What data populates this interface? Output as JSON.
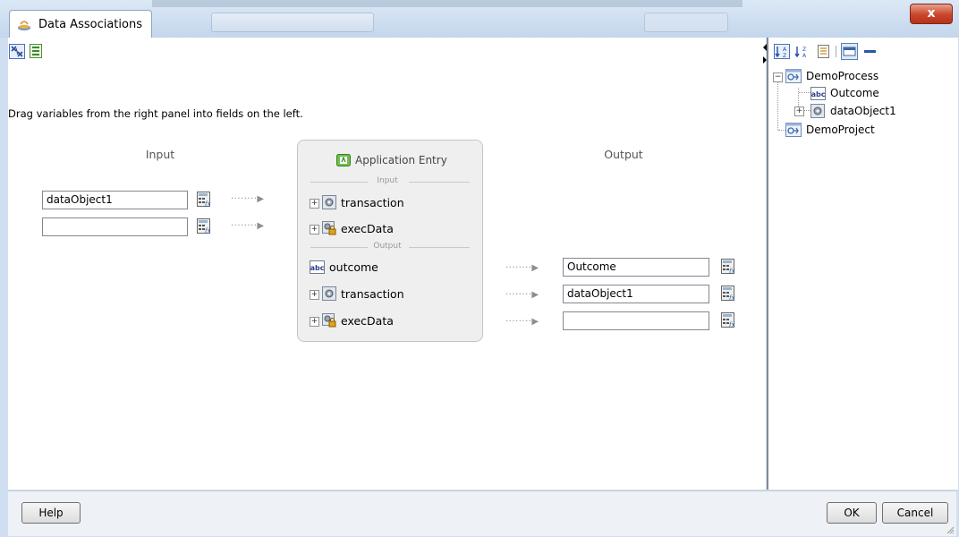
{
  "window": {
    "title": "Data Associations",
    "close_label": "x"
  },
  "description": "Drag variables from the right panel into fields on the left.",
  "input_section": {
    "header": "Input",
    "fields": [
      {
        "value": "dataObject1"
      },
      {
        "value": ""
      }
    ]
  },
  "card": {
    "title": "Application Entry",
    "input_separator": "Input",
    "output_separator": "Output",
    "input_rows": [
      {
        "label": "transaction",
        "icon": "object-icon",
        "expandable": true
      },
      {
        "label": "execData",
        "icon": "locked-object-icon",
        "expandable": true
      }
    ],
    "output_rows": [
      {
        "label": "outcome",
        "icon": "abc-string-icon",
        "expandable": false
      },
      {
        "label": "transaction",
        "icon": "object-icon",
        "expandable": true
      },
      {
        "label": "execData",
        "icon": "locked-object-icon",
        "expandable": true
      }
    ]
  },
  "output_section": {
    "header": "Output",
    "fields": [
      {
        "value": "Outcome"
      },
      {
        "value": "dataObject1"
      },
      {
        "value": ""
      }
    ]
  },
  "tree": {
    "items": [
      {
        "label": "DemoProcess",
        "icon": "process-icon",
        "expanded": true
      },
      {
        "label": "Outcome",
        "icon": "abc-string-icon"
      },
      {
        "label": "dataObject1",
        "icon": "object-icon",
        "expanded": false
      },
      {
        "label": "DemoProject",
        "icon": "process-icon"
      }
    ]
  },
  "buttons": {
    "help": "Help",
    "ok": "OK",
    "cancel": "Cancel"
  },
  "colors": {
    "accent": "#c9452b",
    "panel_border": "#7f8a96"
  }
}
